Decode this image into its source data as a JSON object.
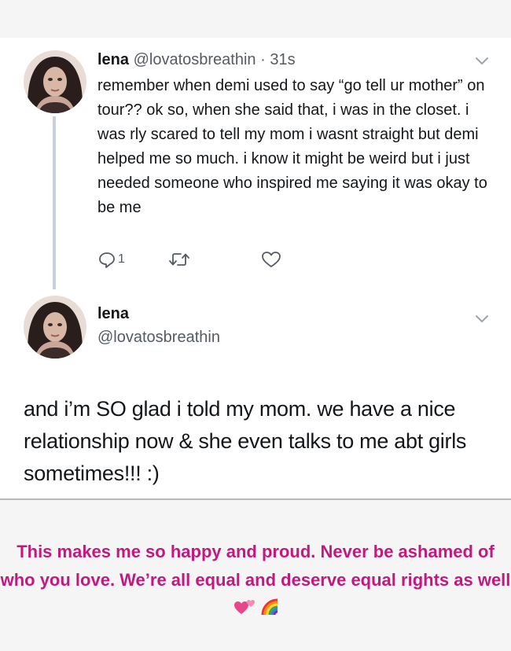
{
  "tweet1": {
    "name": "lena",
    "handle": "@lovatosbreathin",
    "dot": "·",
    "time": "31s",
    "text": "remember when demi used to say “go tell ur mother” on tour?? ok so, when she said that, i was in the closet. i was rly scared to tell my mom i wasnt straight but demi helped me so much. i know it might be weird but i just needed someone who inspired me saying it was okay to be me",
    "reply_count": "1",
    "icons": {
      "reply": "reply-icon",
      "retweet": "retweet-icon",
      "like": "heart-icon",
      "menu": "chevron-down-icon"
    }
  },
  "tweet2": {
    "name": "lena",
    "handle": "@lovatosbreathin",
    "text": "and i’m SO glad i told my mom. we have a nice relationship now & she even talks to me abt girls sometimes!!! :)"
  },
  "caption": {
    "text": "This makes me so happy and proud. Never be ashamed of who you love. We’re all equal and deserve equal rights as well",
    "emoji": [
      "two-hearts-emoji",
      "rainbow-emoji"
    ],
    "color": "#c2187f"
  },
  "colors": {
    "text": "#14171a",
    "muted": "#555b63",
    "thread_line": "#c9d1d8",
    "background": "#f5f5f5",
    "card": "#ffffff"
  }
}
